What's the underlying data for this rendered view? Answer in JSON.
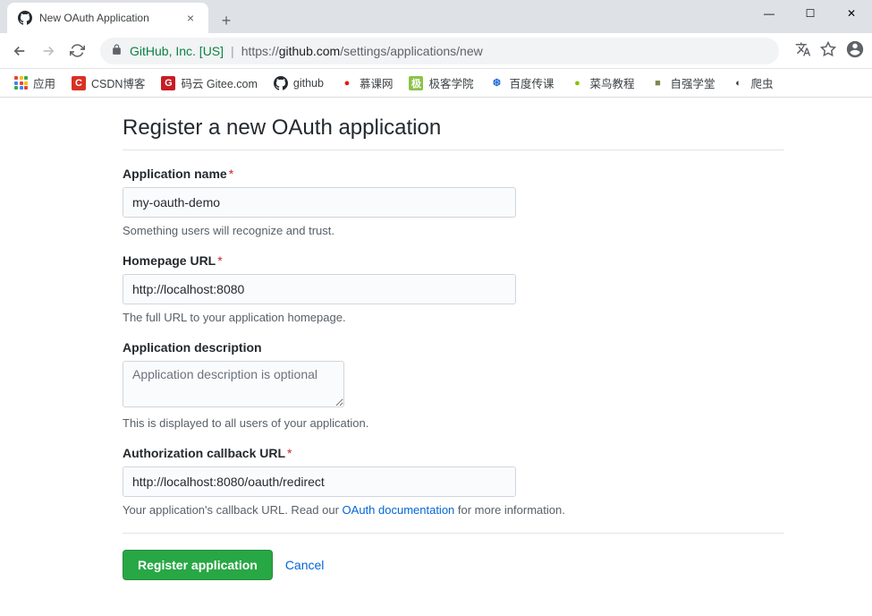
{
  "window": {
    "tab_title": "New OAuth Application"
  },
  "address": {
    "identity": "GitHub, Inc. [US]",
    "protocol": "https://",
    "host": "github.com",
    "path": "/settings/applications/new"
  },
  "bookmarks": {
    "apps": "应用",
    "items": [
      {
        "label": "CSDN博客",
        "icon": "C",
        "bg": "#d93025",
        "fg": "#fff"
      },
      {
        "label": "码云 Gitee.com",
        "icon": "G",
        "bg": "#c71d23",
        "fg": "#fff"
      },
      {
        "label": "github",
        "icon": "gh",
        "bg": "#fff",
        "fg": "#000"
      },
      {
        "label": "慕课网",
        "icon": "●",
        "bg": "#fff",
        "fg": "#f01414"
      },
      {
        "label": "极客学院",
        "icon": "极",
        "bg": "#8bc34a",
        "fg": "#fff"
      },
      {
        "label": "百度传课",
        "icon": "❆",
        "bg": "#fff",
        "fg": "#2b73db"
      },
      {
        "label": "菜鸟教程",
        "icon": "●",
        "bg": "#fff",
        "fg": "#8ac007"
      },
      {
        "label": "自强学堂",
        "icon": "■",
        "bg": "#fff",
        "fg": "#7b8a4b"
      },
      {
        "label": "爬虫",
        "icon": "◐",
        "bg": "#fff",
        "fg": "#333"
      }
    ]
  },
  "page": {
    "title": "Register a new OAuth application",
    "fields": {
      "app_name": {
        "label": "Application name",
        "value": "my-oauth-demo",
        "hint": "Something users will recognize and trust."
      },
      "homepage": {
        "label": "Homepage URL",
        "value": "http://localhost:8080",
        "hint": "The full URL to your application homepage."
      },
      "description": {
        "label": "Application description",
        "placeholder": "Application description is optional",
        "value": "",
        "hint": "This is displayed to all users of your application."
      },
      "callback": {
        "label": "Authorization callback URL",
        "value": "http://localhost:8080/oauth/redirect",
        "hint_pre": "Your application's callback URL. Read our ",
        "hint_link": "OAuth documentation",
        "hint_post": " for more information."
      }
    },
    "actions": {
      "submit": "Register application",
      "cancel": "Cancel"
    }
  }
}
